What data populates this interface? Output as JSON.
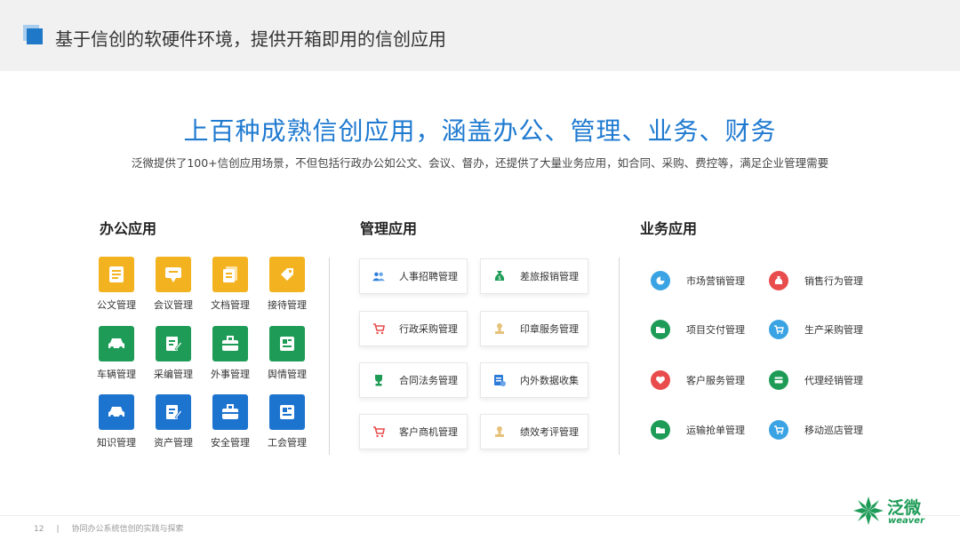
{
  "header": {
    "title": "基于信创的软硬件环境，提供开箱即用的信创应用"
  },
  "headline": "上百种成熟信创应用，涵盖办公、管理、业务、财务",
  "subline": "泛微提供了100+信创应用场景，不但包括行政办公如公文、会议、督办，还提供了大量业务应用，如合同、采购、费控等，满足企业管理需要",
  "office": {
    "heading": "办公应用",
    "items": [
      "公文管理",
      "会议管理",
      "文档管理",
      "接待管理",
      "车辆管理",
      "采编管理",
      "外事管理",
      "舆情管理",
      "知识管理",
      "资产管理",
      "安全管理",
      "工会管理"
    ]
  },
  "mgmt": {
    "heading": "管理应用",
    "items": [
      "人事招聘管理",
      "差旅报销管理",
      "行政采购管理",
      "印章服务管理",
      "合同法务管理",
      "内外数据收集",
      "客户商机管理",
      "绩效考评管理"
    ]
  },
  "biz": {
    "heading": "业务应用",
    "items": [
      "市场营销管理",
      "销售行为管理",
      "项目交付管理",
      "生产采购管理",
      "客户服务管理",
      "代理经销管理",
      "运输抢单管理",
      "移动巡店管理"
    ]
  },
  "footer": {
    "page": "12",
    "text": "协同办公系统信创的实践与探索"
  },
  "logo": {
    "cn": "泛微",
    "en": "weaver"
  },
  "colors": {
    "accent": "#1f7ad0",
    "yellow": "#f3b21f",
    "green": "#1e9c57",
    "blue": "#1d74cf",
    "red": "#e84c4c",
    "lightblue": "#3aa3e3"
  }
}
